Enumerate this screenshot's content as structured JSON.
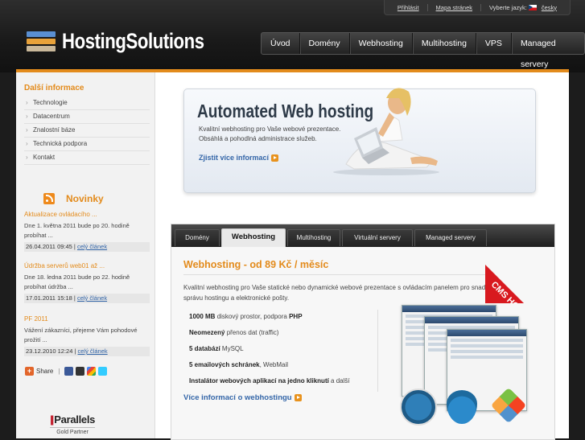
{
  "topbar": {
    "login": "Přihlásit",
    "sitemap": "Mapa stránek",
    "language_label": "Vyberte jazyk:",
    "language_value": "česky"
  },
  "brand": {
    "name": "HostingSolutions"
  },
  "nav": [
    "Úvod",
    "Domény",
    "Webhosting",
    "Multihosting",
    "VPS",
    "Managed servery"
  ],
  "sidebar": {
    "title": "Další informace",
    "items": [
      "Technologie",
      "Datacentrum",
      "Znalostní báze",
      "Technická podpora",
      "Kontakt"
    ],
    "news_title": "Novinky",
    "news": [
      {
        "title": "Aktualizace ovládacího ...",
        "text": "Dne 1. května 2011 bude po 20. hodině probíhat ...",
        "date": "26.04.2011 09:45",
        "link": "celý článek"
      },
      {
        "title": "Údržba serverů web01 až ...",
        "text": "Dne 18. ledna 2011 bude po 22. hodině probíhat údržba ...",
        "date": "17.01.2011 15:18",
        "link": "celý článek"
      },
      {
        "title": "PF 2011",
        "text": "Vážení zákazníci, přejeme Vám pohodové prožití ...",
        "date": "23.12.2010 12:24",
        "link": "celý článek"
      }
    ],
    "share_label": "Share",
    "partner_name": "Parallels",
    "partner_level": "Gold Partner"
  },
  "hero": {
    "title": "Automated Web hosting",
    "line1": "Kvalitní webhosting pro Vaše webové prezentace.",
    "line2": "Obsáhlá a pohodlná administrace služeb.",
    "link": "Zjistit více informací"
  },
  "tabs": [
    "Domény",
    "Webhosting",
    "Multihosting",
    "Virtuální servery",
    "Managed servery"
  ],
  "active_tab": "Webhosting",
  "webhosting": {
    "title": "Webhosting - od 89 Kč / měsíc",
    "desc": "Kvalitní webhosting pro Vaše statické nebo dynamické webové prezentace s ovládacím panelem pro snadnou správu hostingu a elektronické pošty.",
    "features": [
      {
        "bold": "1000 MB",
        "text": " diskový prostor, podpora ",
        "bold2": "PHP"
      },
      {
        "bold": "Neomezený",
        "text": " přenos dat (traffic)",
        "bold2": ""
      },
      {
        "bold": "5 databází",
        "text": " MySQL",
        "bold2": ""
      },
      {
        "bold": "5 emailových schránek",
        "text": ", WebMail",
        "bold2": ""
      },
      {
        "bold": "Instalátor webových aplikací na jedno kliknutí",
        "text": " a další",
        "bold2": ""
      }
    ],
    "more_link": "Více informací o webhostingu",
    "ribbon": "CMS HOSTING"
  },
  "colors": {
    "accent": "#e38b1c",
    "link": "#3466a8",
    "ribbon": "#d8191f"
  }
}
